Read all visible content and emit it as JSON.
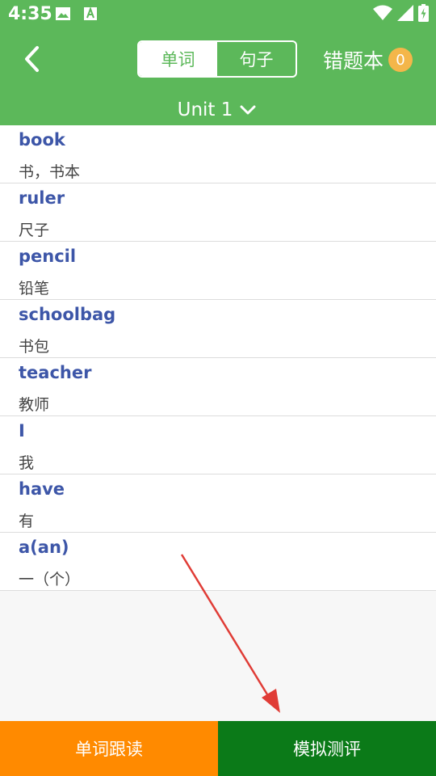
{
  "status_bar": {
    "time": "4:35",
    "icons": [
      "image-icon",
      "font-download-icon",
      "wifi-icon",
      "signal-icon",
      "battery-charging-icon"
    ]
  },
  "header": {
    "back_icon": "chevron-left-icon",
    "tabs": [
      {
        "label": "单词",
        "active": true
      },
      {
        "label": "句子",
        "active": false
      }
    ],
    "wrong_book": {
      "label": "错题本",
      "count": "0"
    },
    "unit": {
      "label": "Unit 1",
      "icon": "chevron-down-icon"
    }
  },
  "words": [
    {
      "en": "book",
      "cn": "书，书本"
    },
    {
      "en": "ruler",
      "cn": "尺子"
    },
    {
      "en": "pencil",
      "cn": "铅笔"
    },
    {
      "en": "schoolbag",
      "cn": "书包"
    },
    {
      "en": "teacher",
      "cn": "教师"
    },
    {
      "en": "I",
      "cn": "我"
    },
    {
      "en": "have",
      "cn": "有"
    },
    {
      "en": "a(an)",
      "cn": "一（个）"
    }
  ],
  "bottom_bar": {
    "follow_read_label": "单词跟读",
    "mock_test_label": "模拟测评"
  },
  "colors": {
    "header_green": "#5cb85a",
    "word_blue": "#3d56a8",
    "follow_orange": "#ff8a00",
    "test_green": "#0b7a18",
    "badge_yellow": "#f4b64a",
    "arrow_red": "#e03c36"
  }
}
